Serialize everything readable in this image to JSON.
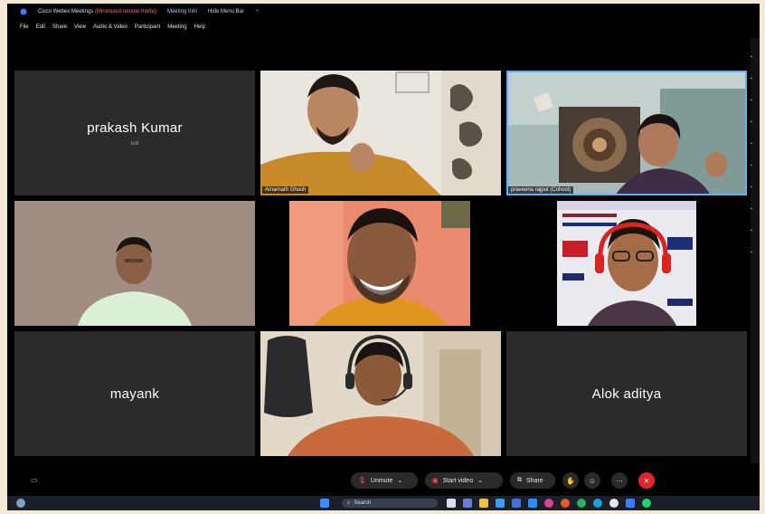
{
  "window": {
    "title": "Cisco Webex Meetings",
    "title_note": "(Minimized remote mode)",
    "meeting_info": "Meeting Info",
    "hide_menu": "Hide Menu Bar"
  },
  "menu": [
    "File",
    "Edit",
    "Share",
    "View",
    "Audio & Video",
    "Participant",
    "Meeting",
    "Help"
  ],
  "participants": [
    {
      "name": "prakash Kumar",
      "subtitle": "Edit",
      "video": false
    },
    {
      "name": "Amarnath Ghosh",
      "video": true
    },
    {
      "name": "praveena rajput (Cohost)",
      "video": true,
      "active": true
    },
    {
      "name": "",
      "video": true
    },
    {
      "name": "",
      "video": true
    },
    {
      "name": "",
      "video": true
    },
    {
      "name": "mayank",
      "video": false
    },
    {
      "name": "",
      "video": true
    },
    {
      "name": "Alok aditya",
      "video": false
    }
  ],
  "controls": {
    "unmute": "Unmute",
    "start_video": "Start video",
    "share": "Share"
  },
  "taskbar": {
    "search": "Search"
  }
}
